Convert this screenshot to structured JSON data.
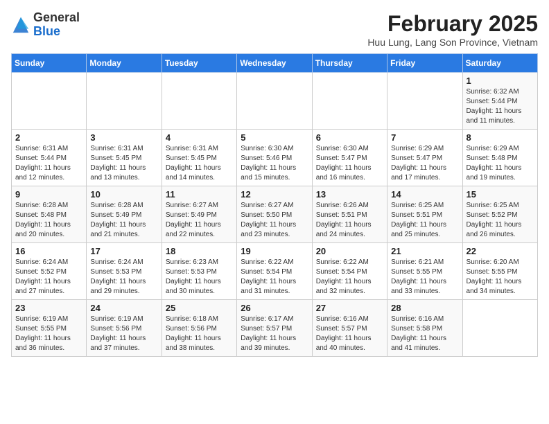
{
  "header": {
    "logo_general": "General",
    "logo_blue": "Blue",
    "month_year": "February 2025",
    "location": "Huu Lung, Lang Son Province, Vietnam"
  },
  "days_of_week": [
    "Sunday",
    "Monday",
    "Tuesday",
    "Wednesday",
    "Thursday",
    "Friday",
    "Saturday"
  ],
  "weeks": [
    [
      {
        "day": "",
        "info": ""
      },
      {
        "day": "",
        "info": ""
      },
      {
        "day": "",
        "info": ""
      },
      {
        "day": "",
        "info": ""
      },
      {
        "day": "",
        "info": ""
      },
      {
        "day": "",
        "info": ""
      },
      {
        "day": "1",
        "info": "Sunrise: 6:32 AM\nSunset: 5:44 PM\nDaylight: 11 hours and 11 minutes."
      }
    ],
    [
      {
        "day": "2",
        "info": "Sunrise: 6:31 AM\nSunset: 5:44 PM\nDaylight: 11 hours and 12 minutes."
      },
      {
        "day": "3",
        "info": "Sunrise: 6:31 AM\nSunset: 5:45 PM\nDaylight: 11 hours and 13 minutes."
      },
      {
        "day": "4",
        "info": "Sunrise: 6:31 AM\nSunset: 5:45 PM\nDaylight: 11 hours and 14 minutes."
      },
      {
        "day": "5",
        "info": "Sunrise: 6:30 AM\nSunset: 5:46 PM\nDaylight: 11 hours and 15 minutes."
      },
      {
        "day": "6",
        "info": "Sunrise: 6:30 AM\nSunset: 5:47 PM\nDaylight: 11 hours and 16 minutes."
      },
      {
        "day": "7",
        "info": "Sunrise: 6:29 AM\nSunset: 5:47 PM\nDaylight: 11 hours and 17 minutes."
      },
      {
        "day": "8",
        "info": "Sunrise: 6:29 AM\nSunset: 5:48 PM\nDaylight: 11 hours and 19 minutes."
      }
    ],
    [
      {
        "day": "9",
        "info": "Sunrise: 6:28 AM\nSunset: 5:48 PM\nDaylight: 11 hours and 20 minutes."
      },
      {
        "day": "10",
        "info": "Sunrise: 6:28 AM\nSunset: 5:49 PM\nDaylight: 11 hours and 21 minutes."
      },
      {
        "day": "11",
        "info": "Sunrise: 6:27 AM\nSunset: 5:49 PM\nDaylight: 11 hours and 22 minutes."
      },
      {
        "day": "12",
        "info": "Sunrise: 6:27 AM\nSunset: 5:50 PM\nDaylight: 11 hours and 23 minutes."
      },
      {
        "day": "13",
        "info": "Sunrise: 6:26 AM\nSunset: 5:51 PM\nDaylight: 11 hours and 24 minutes."
      },
      {
        "day": "14",
        "info": "Sunrise: 6:25 AM\nSunset: 5:51 PM\nDaylight: 11 hours and 25 minutes."
      },
      {
        "day": "15",
        "info": "Sunrise: 6:25 AM\nSunset: 5:52 PM\nDaylight: 11 hours and 26 minutes."
      }
    ],
    [
      {
        "day": "16",
        "info": "Sunrise: 6:24 AM\nSunset: 5:52 PM\nDaylight: 11 hours and 27 minutes."
      },
      {
        "day": "17",
        "info": "Sunrise: 6:24 AM\nSunset: 5:53 PM\nDaylight: 11 hours and 29 minutes."
      },
      {
        "day": "18",
        "info": "Sunrise: 6:23 AM\nSunset: 5:53 PM\nDaylight: 11 hours and 30 minutes."
      },
      {
        "day": "19",
        "info": "Sunrise: 6:22 AM\nSunset: 5:54 PM\nDaylight: 11 hours and 31 minutes."
      },
      {
        "day": "20",
        "info": "Sunrise: 6:22 AM\nSunset: 5:54 PM\nDaylight: 11 hours and 32 minutes."
      },
      {
        "day": "21",
        "info": "Sunrise: 6:21 AM\nSunset: 5:55 PM\nDaylight: 11 hours and 33 minutes."
      },
      {
        "day": "22",
        "info": "Sunrise: 6:20 AM\nSunset: 5:55 PM\nDaylight: 11 hours and 34 minutes."
      }
    ],
    [
      {
        "day": "23",
        "info": "Sunrise: 6:19 AM\nSunset: 5:55 PM\nDaylight: 11 hours and 36 minutes."
      },
      {
        "day": "24",
        "info": "Sunrise: 6:19 AM\nSunset: 5:56 PM\nDaylight: 11 hours and 37 minutes."
      },
      {
        "day": "25",
        "info": "Sunrise: 6:18 AM\nSunset: 5:56 PM\nDaylight: 11 hours and 38 minutes."
      },
      {
        "day": "26",
        "info": "Sunrise: 6:17 AM\nSunset: 5:57 PM\nDaylight: 11 hours and 39 minutes."
      },
      {
        "day": "27",
        "info": "Sunrise: 6:16 AM\nSunset: 5:57 PM\nDaylight: 11 hours and 40 minutes."
      },
      {
        "day": "28",
        "info": "Sunrise: 6:16 AM\nSunset: 5:58 PM\nDaylight: 11 hours and 41 minutes."
      },
      {
        "day": "",
        "info": ""
      }
    ]
  ]
}
